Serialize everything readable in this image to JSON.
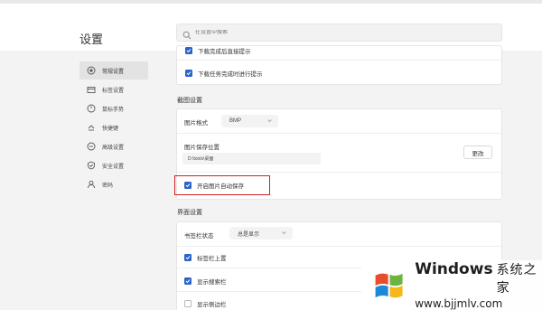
{
  "header": {
    "title": "设置",
    "search_placeholder": "在设置中搜索"
  },
  "sidebar": {
    "items": [
      {
        "label": "常规设置",
        "icon": "target-icon",
        "active": true
      },
      {
        "label": "标签设置",
        "icon": "tab-icon",
        "active": false
      },
      {
        "label": "鼠标手势",
        "icon": "mouse-icon",
        "active": false
      },
      {
        "label": "快捷键",
        "icon": "keyboard-icon",
        "active": false
      },
      {
        "label": "高级设置",
        "icon": "advanced-icon",
        "active": false
      },
      {
        "label": "安全设置",
        "icon": "shield-icon",
        "active": false
      },
      {
        "label": "密码",
        "icon": "user-icon",
        "active": false
      }
    ]
  },
  "download": {
    "partial_label": "下载完成后直接提示",
    "notify_label": "下载任务完成时进行提示",
    "notify_checked": true
  },
  "screenshot": {
    "section_title": "截图设置",
    "format_label": "图片格式",
    "format_value": "BMP",
    "save_location_label": "图片保存位置",
    "save_path": "D:\\tools\\桌面",
    "change_button": "更改",
    "auto_save_label": "开启图片自动保存",
    "auto_save_checked": true
  },
  "interface": {
    "section_title": "界面设置",
    "tabbar_label": "书签栏状态",
    "tabbar_value": "总是显示",
    "tabs_on_top_label": "标签栏上置",
    "tabs_on_top_checked": true,
    "show_search_label": "显示搜索栏",
    "show_search_checked": true,
    "show_sidebar_label": "显示侧边栏",
    "show_sidebar_checked": false
  },
  "watermark": {
    "title": "Windows",
    "subtitle": "系统之家",
    "url": "www.bjjmlv.com"
  },
  "colors": {
    "accent": "#2a63c9",
    "highlight": "#d42020"
  }
}
